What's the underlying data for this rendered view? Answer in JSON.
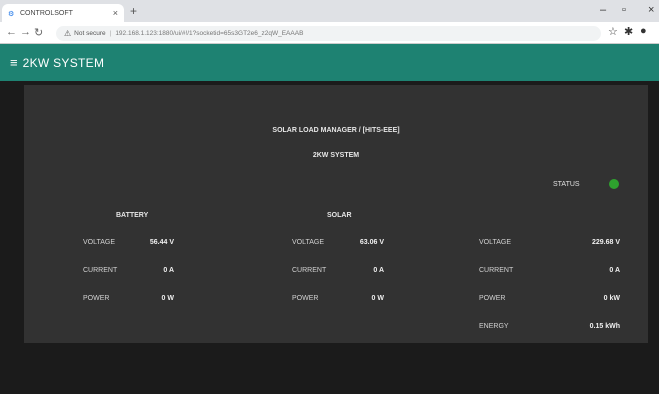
{
  "browser": {
    "tab_title": "CONTROLSOFT",
    "tab_close": "×",
    "new_tab": "+",
    "not_secure": "Not secure",
    "url": "192.168.1.123:1880/ui/#!/1?socketid=65s3GT2e6_z2qW_EAAAB"
  },
  "app": {
    "title": "2KW SYSTEM"
  },
  "panel": {
    "title": "SOLAR LOAD MANAGER / [HITS-EEE]",
    "subtitle": "2KW SYSTEM",
    "status_label": "STATUS",
    "status_color": "#2ea22e"
  },
  "battery": {
    "heading": "BATTERY",
    "voltage_label": "VOLTAGE",
    "voltage": "56.44 V",
    "current_label": "CURRENT",
    "current": "0 A",
    "power_label": "POWER",
    "power": "0 W"
  },
  "solar": {
    "heading": "SOLAR",
    "voltage_label": "VOLTAGE",
    "voltage": "63.06 V",
    "current_label": "CURRENT",
    "current": "0 A",
    "power_label": "POWER",
    "power": "0 W"
  },
  "grid": {
    "voltage_label": "VOLTAGE",
    "voltage": "229.68 V",
    "current_label": "CURRENT",
    "current": "0 A",
    "power_label": "POWER",
    "power": "0 kW",
    "energy_label": "ENERGY",
    "energy": "0.15 kWh"
  }
}
